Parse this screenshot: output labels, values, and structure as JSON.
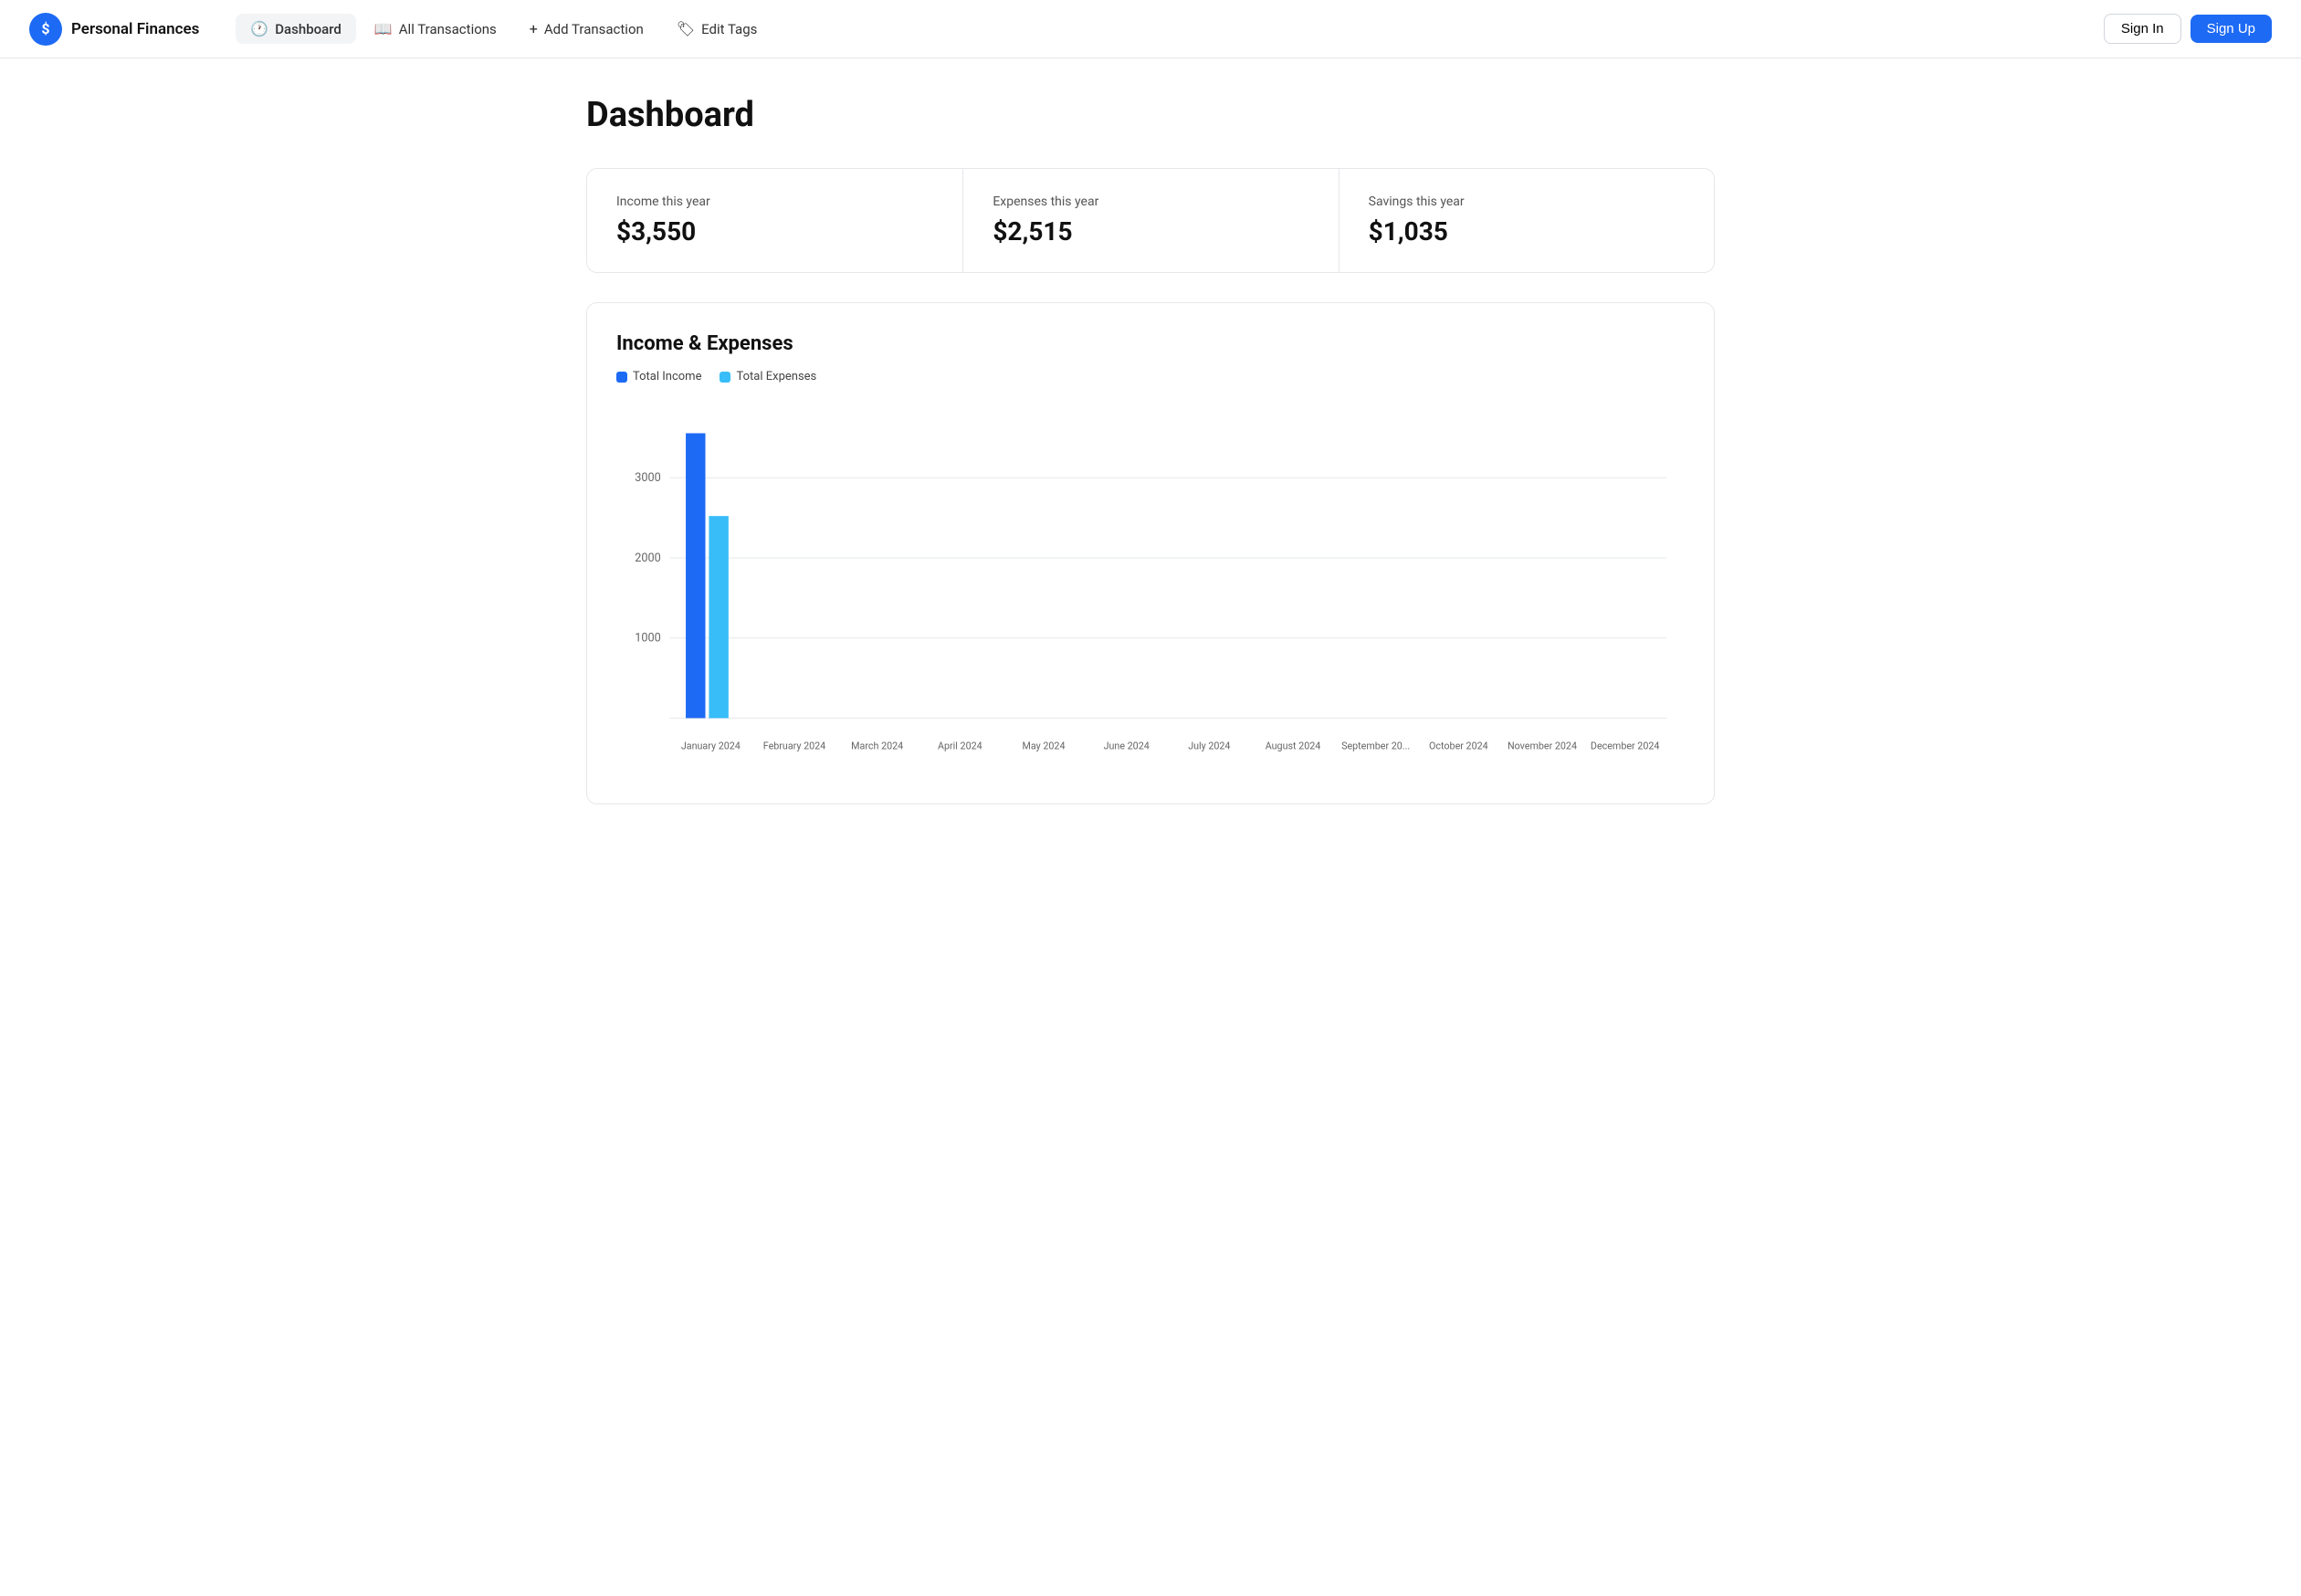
{
  "brand": {
    "icon_label": "$",
    "name": "Personal Finances"
  },
  "nav": {
    "items": [
      {
        "id": "dashboard",
        "label": "Dashboard",
        "icon": "🕐",
        "active": true
      },
      {
        "id": "all-transactions",
        "label": "All Transactions",
        "icon": "📖",
        "active": false
      },
      {
        "id": "add-transaction",
        "label": "Add Transaction",
        "icon": "+",
        "active": false
      },
      {
        "id": "edit-tags",
        "label": "Edit Tags",
        "icon": "🏷",
        "active": false
      }
    ],
    "signin_label": "Sign In",
    "signup_label": "Sign Up"
  },
  "page": {
    "title": "Dashboard"
  },
  "summary": {
    "income": {
      "label": "Income this year",
      "value": "$3,550"
    },
    "expenses": {
      "label": "Expenses this year",
      "value": "$2,515"
    },
    "savings": {
      "label": "Savings this year",
      "value": "$1,035"
    }
  },
  "chart": {
    "title": "Income & Expenses",
    "legend": {
      "income_label": "Total Income",
      "expenses_label": "Total Expenses"
    },
    "x_labels": [
      "January 2024",
      "February 2024",
      "March 2024",
      "April 2024",
      "May 2024",
      "June 2024",
      "July 2024",
      "August 2024",
      "September 20...",
      "October 2024",
      "November 2024",
      "December 2024"
    ],
    "y_labels": [
      "3000",
      "2000",
      "1000"
    ],
    "bars": {
      "income": [
        3550,
        0,
        0,
        0,
        0,
        0,
        0,
        0,
        0,
        0,
        0,
        0
      ],
      "expenses": [
        2515,
        0,
        0,
        0,
        0,
        0,
        0,
        0,
        0,
        0,
        0,
        0
      ]
    },
    "max_value": 3550
  }
}
